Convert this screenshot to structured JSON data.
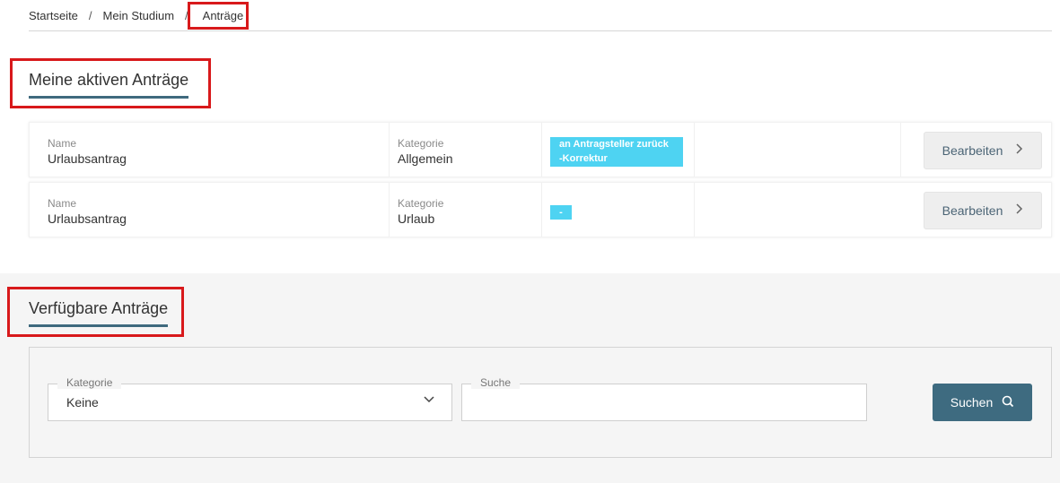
{
  "breadcrumb": {
    "items": [
      "Startseite",
      "Mein Studium"
    ],
    "separator": "/",
    "current": "Anträge"
  },
  "active_section": {
    "title": "Meine aktiven Anträge",
    "requests": [
      {
        "name_label": "Name",
        "name_value": "Urlaubsantrag",
        "category_label": "Kategorie",
        "category_value": "Allgemein",
        "status_line1": "an Antragsteller zurück",
        "status_line2": "-Korrektur",
        "edit_label": "Bearbeiten"
      },
      {
        "name_label": "Name",
        "name_value": "Urlaubsantrag",
        "category_label": "Kategorie",
        "category_value": "Urlaub",
        "status_line1": "-",
        "edit_label": "Bearbeiten"
      }
    ]
  },
  "available_section": {
    "title": "Verfügbare Anträge",
    "category_field": {
      "legend": "Kategorie",
      "value": "Keine"
    },
    "search_field": {
      "legend": "Suche",
      "value": ""
    },
    "search_button": "Suchen"
  },
  "colors": {
    "accent": "#3e6b80",
    "status": "#4ed3f2",
    "highlight": "#d8191b"
  },
  "icons": [
    "chevron-right-icon",
    "chevron-down-icon",
    "search-icon"
  ]
}
